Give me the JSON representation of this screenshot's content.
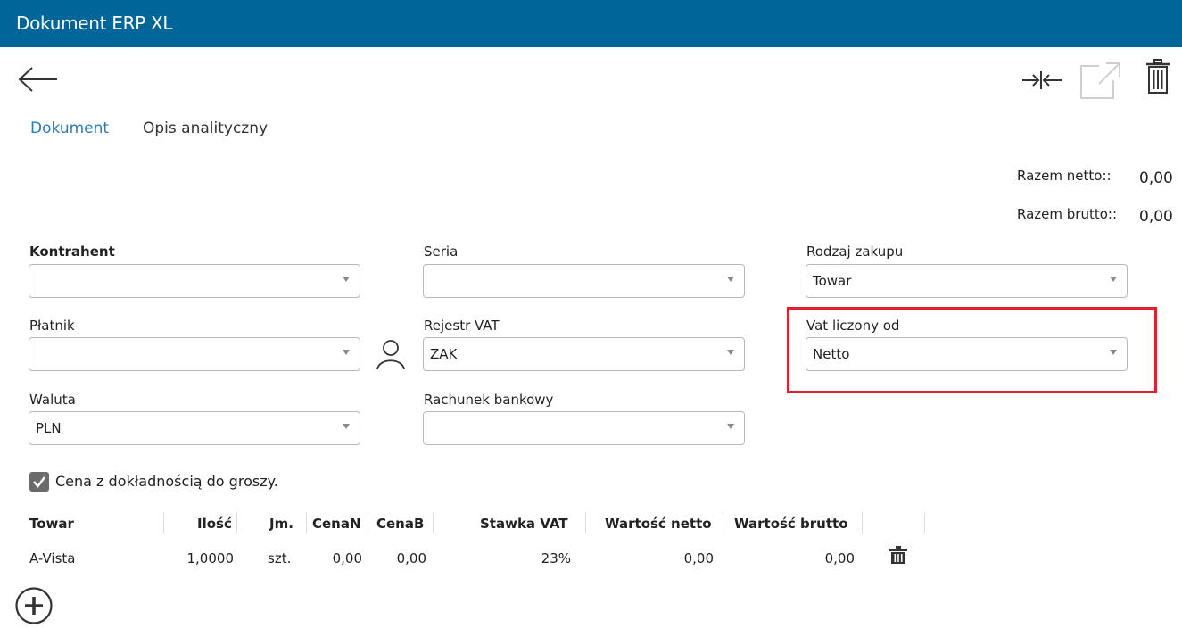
{
  "window": {
    "title": "Dokument ERP XL"
  },
  "toolbar": {
    "back_icon": "arrow-left-icon",
    "collapse_icon": "collapse-horizontal-icon",
    "open_external_icon": "external-link-icon",
    "delete_icon": "trash-icon"
  },
  "tabs": [
    {
      "label": "Dokument",
      "active": true
    },
    {
      "label": "Opis analityczny",
      "active": false
    }
  ],
  "totals": {
    "netto_label": "Razem netto::",
    "netto_value": "0,00",
    "brutto_label": "Razem brutto::",
    "brutto_value": "0,00"
  },
  "form": {
    "kontrahent": {
      "label": "Kontrahent",
      "value": ""
    },
    "platnik": {
      "label": "Płatnik",
      "value": ""
    },
    "waluta": {
      "label": "Waluta",
      "value": "PLN"
    },
    "seria": {
      "label": "Seria",
      "value": ""
    },
    "rejestr_vat": {
      "label": "Rejestr VAT",
      "value": "ZAK"
    },
    "rachunek_bankowy": {
      "label": "Rachunek bankowy",
      "value": ""
    },
    "rodzaj_zakupu": {
      "label": "Rodzaj zakupu",
      "value": "Towar"
    },
    "vat_liczony_od": {
      "label": "Vat liczony od",
      "value": "Netto"
    }
  },
  "checkbox": {
    "label": "Cena z dokładnością do groszy.",
    "checked": true
  },
  "table": {
    "headers": [
      "Towar",
      "Ilość",
      "Jm.",
      "CenaN",
      "CenaB",
      "Stawka VAT",
      "Wartość netto",
      "Wartość brutto"
    ],
    "rows": [
      [
        "A-Vista",
        "1,0000",
        "szt.",
        "0,00",
        "0,00",
        "23%",
        "0,00",
        "0,00"
      ]
    ]
  },
  "colors": {
    "titlebar": "#006699",
    "active_tab": "#2a7bbd",
    "highlight": "#e0202a"
  }
}
